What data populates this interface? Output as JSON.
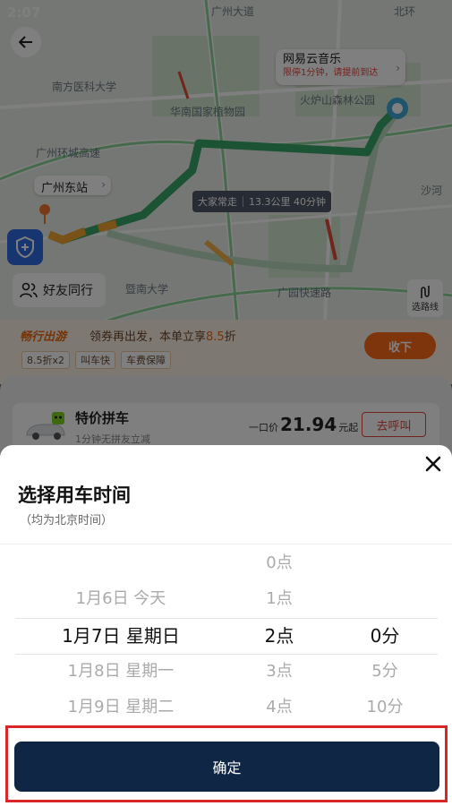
{
  "status_bar": {
    "time": "2:07"
  },
  "map": {
    "labels": {
      "school": "南方医科大学",
      "garden": "华南国家植物园",
      "park": "火炉山森林公园",
      "jinan": "暨南大学",
      "expressway1": "广州环城高速",
      "expressway2": "广园快速路",
      "highway": "广州大道",
      "shahe": "沙河",
      "huhu": "北环"
    },
    "destination": {
      "name": "网易云音乐",
      "note": "限停1分钟，请提前到达"
    },
    "origin": {
      "name": "广州东站"
    },
    "route_info": {
      "tag": "大家常走",
      "summary": "13.3公里 40分钟"
    },
    "friends_label": "好友同行",
    "route_select_label": "选路线"
  },
  "promo": {
    "logo": "畅行出游",
    "text_prefix": "领券再出发，本单立享",
    "text_highlight": "8.5",
    "text_suffix": "折",
    "tags": [
      "8.5折x2",
      "叫车快",
      "车费保障"
    ],
    "button": "收下"
  },
  "ride_option": {
    "name": "特价拼车",
    "subtitle": "1分钟无拼友立减",
    "price_prefix": "一口价",
    "price": "21.94",
    "price_suffix": "元起",
    "call_button": "去呼叫"
  },
  "time_picker": {
    "title": "选择用车时间",
    "subtitle": "（均为北京时间）",
    "date_column": [
      "",
      "1月6日 今天",
      "1月7日 星期日",
      "1月8日 星期一",
      "1月9日 星期二"
    ],
    "hour_column": [
      "0点",
      "1点",
      "2点",
      "3点",
      "4点"
    ],
    "minute_column": [
      "",
      "",
      "0分",
      "5分",
      "10分"
    ],
    "selected_index": 2,
    "confirm_button": "确定"
  }
}
